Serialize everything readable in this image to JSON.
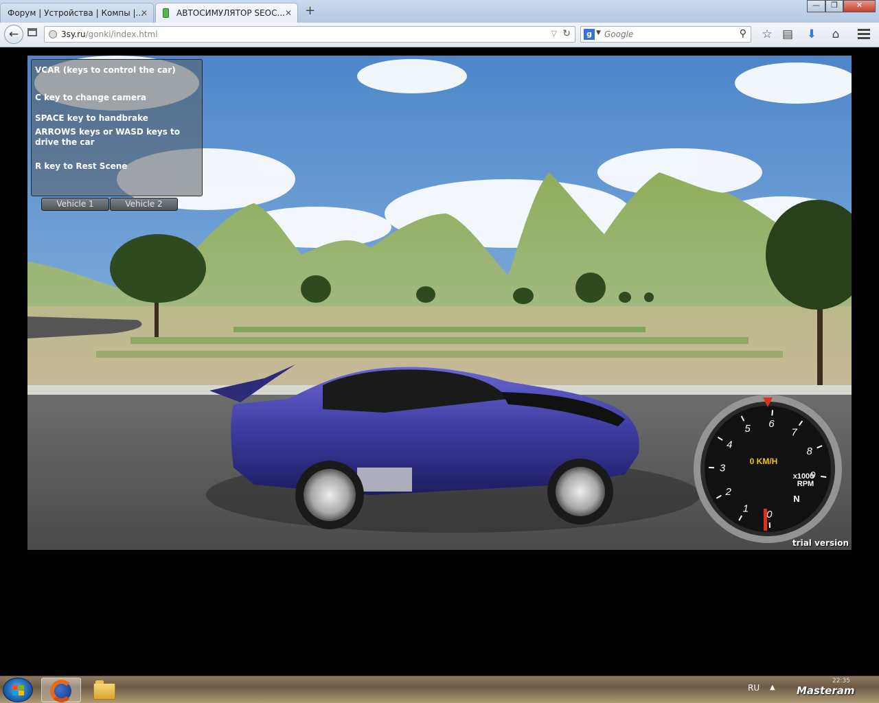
{
  "browser": {
    "tabs": [
      {
        "label": "Форум | Устройства | Компы |...",
        "active": false
      },
      {
        "label": "АВТОСИМУЛЯТОР SEOC...",
        "active": true
      }
    ],
    "new_tab_symbol": "+",
    "close_symbol": "✕",
    "url_host": "3sy.ru",
    "url_path": "/gonki/index.html",
    "search_placeholder": "Google",
    "search_engine_letter": "g"
  },
  "game": {
    "controls_panel": {
      "title": "VCAR (keys to control the car)",
      "camera": "C key to change camera",
      "handbrake": "SPACE key to handbrake",
      "drive": "ARROWS keys or WASD keys to drive the car",
      "reset": "R key to Rest Scene"
    },
    "vehicle_buttons": [
      "Vehicle 1",
      "Vehicle 2"
    ],
    "speedometer": {
      "speed_text": "0 KM/H",
      "unit_text_1": "x1000",
      "unit_text_2": "RPM",
      "gear": "N",
      "rpm_ticks": [
        "0",
        "1",
        "2",
        "3",
        "4",
        "5",
        "6",
        "7",
        "8",
        "9"
      ],
      "rpm_value": 0,
      "rpm_max": 9
    },
    "trial_label": "trial version",
    "car_color": "#3d3aa0"
  },
  "taskbar": {
    "language": "RU",
    "time_partial": "22:35",
    "watermark": "Masteram"
  }
}
